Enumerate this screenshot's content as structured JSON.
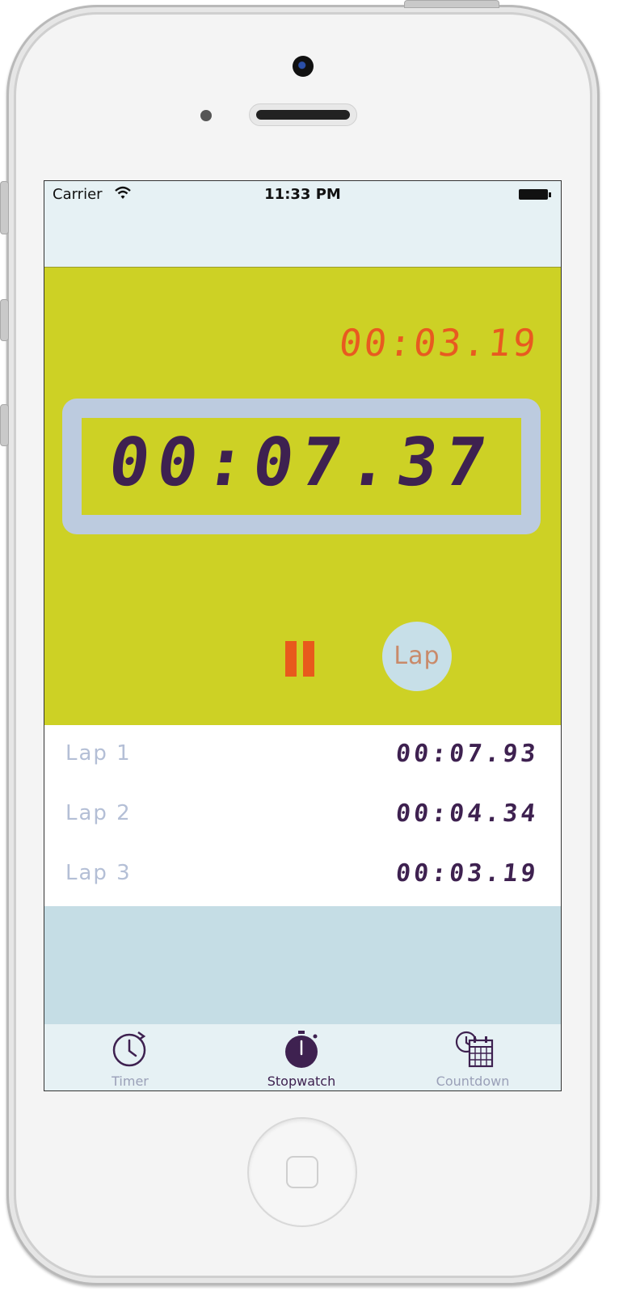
{
  "status_bar": {
    "carrier": "Carrier",
    "time": "11:33 PM"
  },
  "stopwatch": {
    "last_lap_time": "00:03.19",
    "main_time": "00:07.37",
    "lap_button_label": "Lap"
  },
  "laps": [
    {
      "label": "Lap 1",
      "time": "00:07.93"
    },
    {
      "label": "Lap 2",
      "time": "00:04.34"
    },
    {
      "label": "Lap 3",
      "time": "00:03.19"
    }
  ],
  "tab_bar": {
    "tabs": [
      {
        "label": "Timer",
        "icon": "timer-icon"
      },
      {
        "label": "Stopwatch",
        "icon": "stopwatch-icon",
        "selected": true
      },
      {
        "label": "Countdown",
        "icon": "countdown-icon"
      }
    ]
  },
  "colors": {
    "accent_yellow": "#cdd125",
    "accent_orange": "#e85a1c",
    "digit_purple": "#3e2150",
    "display_frame": "#bccbdf",
    "bar_background": "#e6f1f4"
  }
}
